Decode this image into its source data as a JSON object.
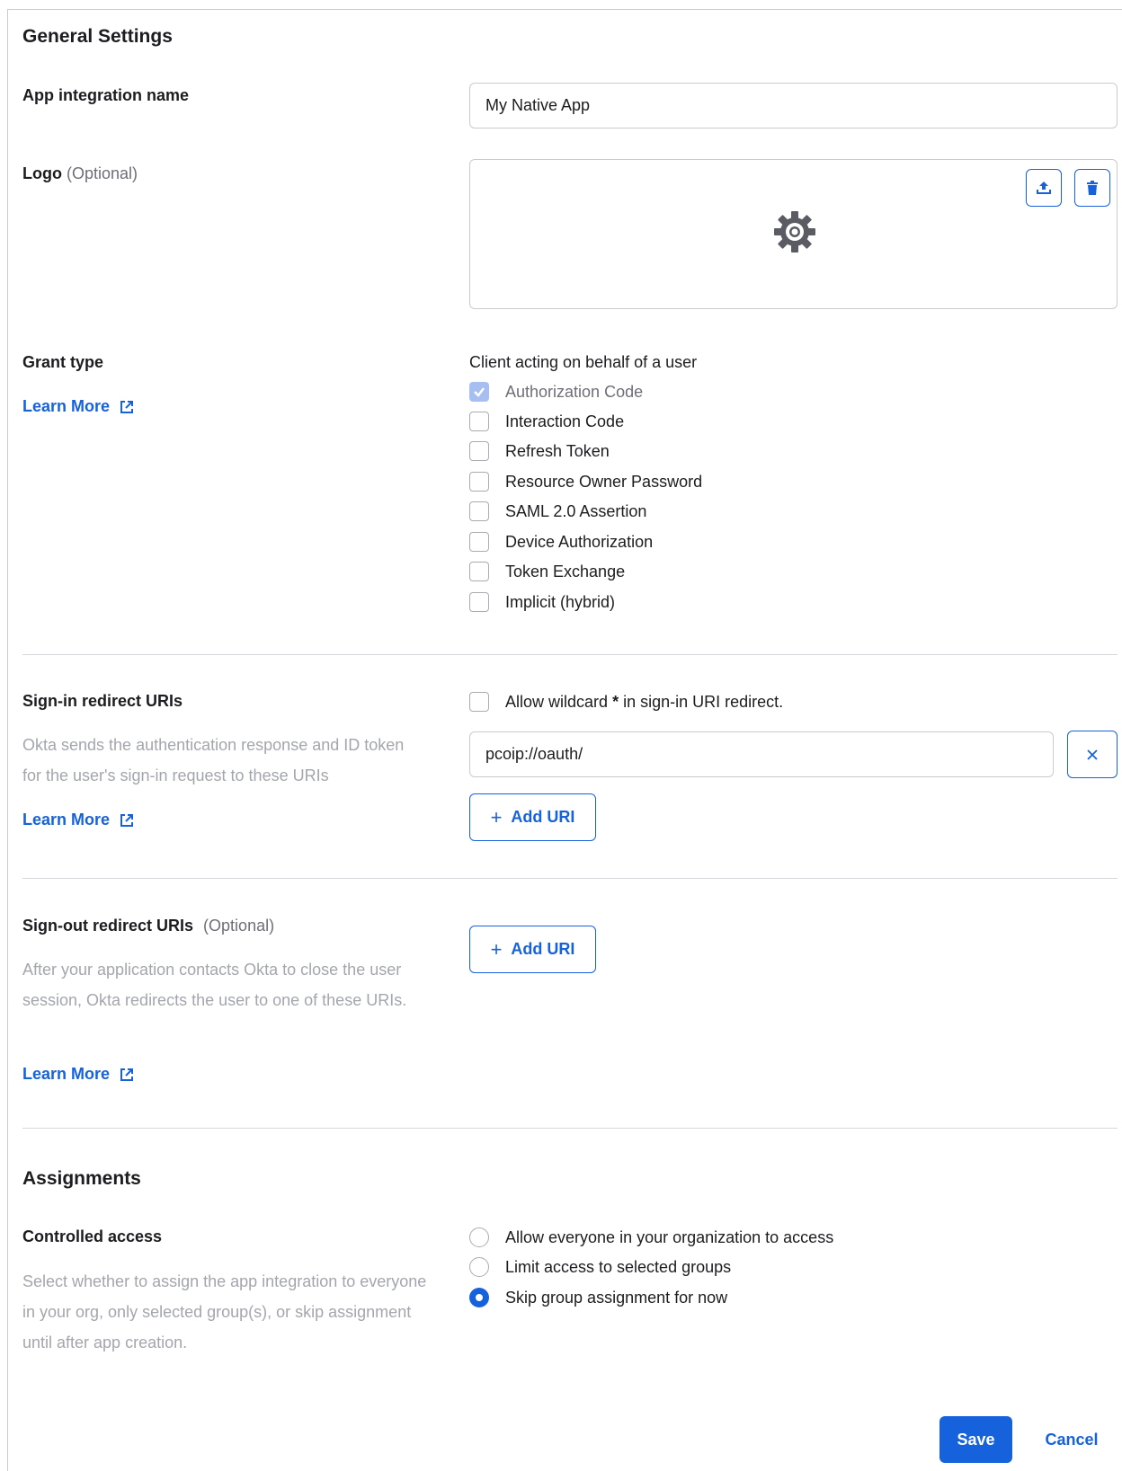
{
  "general": {
    "title": "General Settings",
    "app_name_label": "App integration name",
    "app_name_value": "My Native App",
    "logo_label": "Logo",
    "logo_optional": "(Optional)",
    "grant_type_label": "Grant type",
    "learn_more": "Learn More",
    "grant_heading": "Client acting on behalf of a user",
    "grant_options": [
      {
        "label": "Authorization Code",
        "checked": true,
        "disabled": true
      },
      {
        "label": "Interaction Code",
        "checked": false
      },
      {
        "label": "Refresh Token",
        "checked": false
      },
      {
        "label": "Resource Owner Password",
        "checked": false
      },
      {
        "label": "SAML 2.0 Assertion",
        "checked": false
      },
      {
        "label": "Device Authorization",
        "checked": false
      },
      {
        "label": "Token Exchange",
        "checked": false
      },
      {
        "label": "Implicit (hybrid)",
        "checked": false
      }
    ]
  },
  "signin": {
    "label": "Sign-in redirect URIs",
    "description": "Okta sends the authentication response and ID token for the user's sign-in request to these URIs",
    "learn_more": "Learn More",
    "wildcard_prefix": "Allow wildcard",
    "wildcard_star": "*",
    "wildcard_suffix": "in sign-in URI redirect.",
    "uri_value": "pcoip://oauth/",
    "add_uri": "Add URI"
  },
  "signout": {
    "label": "Sign-out redirect URIs",
    "optional": "(Optional)",
    "description": "After your application contacts Okta to close the user session, Okta redirects the user to one of these URIs.",
    "learn_more": "Learn More",
    "add_uri": "Add URI"
  },
  "assignments": {
    "title": "Assignments",
    "controlled_label": "Controlled access",
    "description": "Select whether to assign the app integration to everyone in your org, only selected group(s), or skip assignment until after app creation.",
    "options": [
      {
        "label": "Allow everyone in your organization to access",
        "selected": false
      },
      {
        "label": "Limit access to selected groups",
        "selected": false
      },
      {
        "label": "Skip group assignment for now",
        "selected": true
      }
    ]
  },
  "footer": {
    "save": "Save",
    "cancel": "Cancel"
  },
  "colors": {
    "accent": "#1662dd",
    "muted_text": "#a4a6ad",
    "border": "#c9cbd1"
  },
  "icons": {
    "logo_placeholder": "gear-icon",
    "upload": "upload-icon",
    "delete": "trash-icon",
    "external": "external-link-icon",
    "remove_uri": "close-icon"
  }
}
